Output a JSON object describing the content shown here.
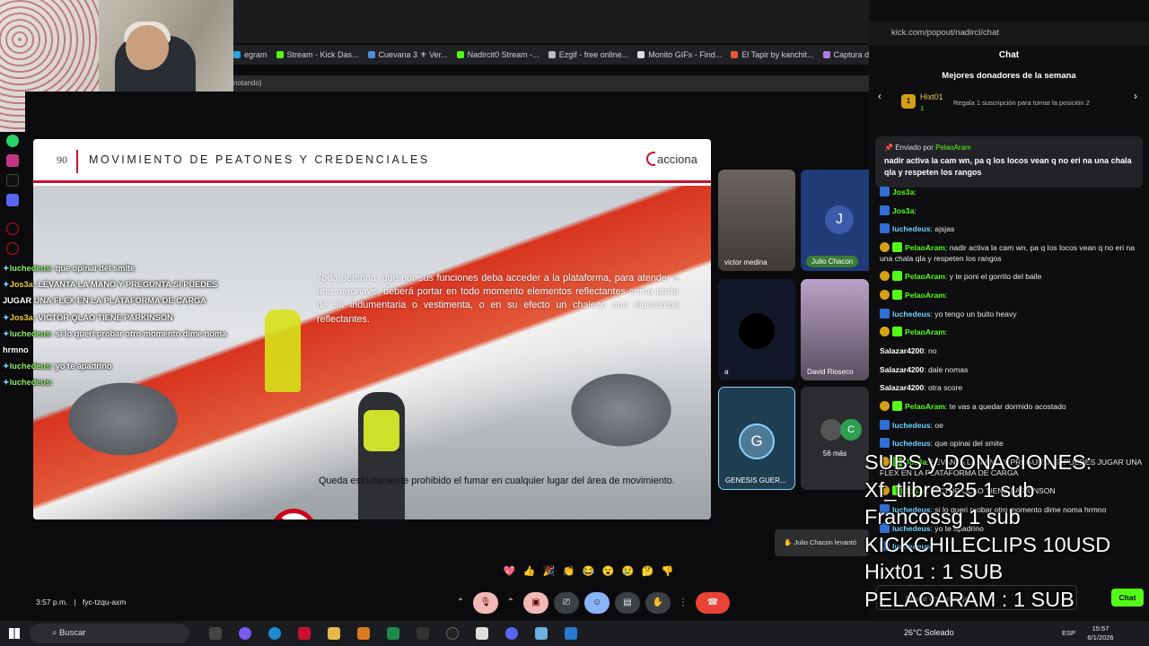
{
  "browser": {
    "bookmarks": [
      {
        "label": "egram",
        "color": "#2aa0e0"
      },
      {
        "label": "Stream - Kick Das...",
        "color": "#53fc18"
      },
      {
        "label": "Cuevana 3 ⚜ Ver...",
        "color": "#4f8bd6"
      },
      {
        "label": "Nadircit0 Stream -...",
        "color": "#53fc18"
      },
      {
        "label": "Ezgif - free online...",
        "color": "#bbbbbb"
      },
      {
        "label": "Monito GIFs - Find...",
        "color": "#dddddd"
      },
      {
        "label": "El Tapir by kanchit...",
        "color": "#e25a3a"
      },
      {
        "label": "Captura de",
        "color": "#b07be0"
      }
    ],
    "tab_suffix": "notando)"
  },
  "slide": {
    "number": "90",
    "title": "MOVIMIENTO DE PEATONES Y CREDENCIALES",
    "logo": "acciona",
    "paragraph1": "Toda persona, que por sus funciones deba acceder a la plataforma, para atender a una aeronave, deberá portar en todo momento elementos reflectantes como parte de su indumentaria o vestimenta, o en su efecto un chaleco con elementos reflectantes.",
    "paragraph2": "Queda estrictamente prohibido el fumar en cualquier lugar del área de movimiento."
  },
  "overlay_chat": [
    {
      "user": "luchedeus",
      "msg": "que opinai del smite",
      "gold": false
    },
    {
      "user": "Jos3a",
      "msg": "LEVANTA LA MANO Y PREGUNTA SI PUEDES JUGAR UNA FLEX EN LA PLATAFORMA DE CARGA",
      "gold": true
    },
    {
      "user": "Jos3a",
      "msg": "VICTOR QLAO TIENE PARKINSON",
      "gold": true
    },
    {
      "user": "luchedeus",
      "msg": "si lo queri probar otro momento dime noma hrmno",
      "gold": false
    },
    {
      "user": "luchedeus",
      "msg": "yo te apadrino",
      "gold": false
    },
    {
      "user": "luchedeus",
      "msg": "",
      "gold": false
    }
  ],
  "participants": {
    "victor": "victor medina",
    "julio_initial": "J",
    "julio": "Julio Chacon",
    "a": "a",
    "david": "David Rioseco",
    "genesis_initial": "G",
    "genesis": "GENESIS GUER...",
    "more_initial": "C",
    "more": "56 más"
  },
  "meet": {
    "time": "3:57 p.m.",
    "separator": "|",
    "code": "fyc-tzqu-axm",
    "toast": "Julio Chacon levantó",
    "reactions": [
      "💖",
      "👍",
      "🎉",
      "👏",
      "😂",
      "😮",
      "😢",
      "🤔",
      "👎"
    ]
  },
  "chat": {
    "url": "kick.com/popout/nadircl/chat",
    "title": "Chat",
    "donors_title": "Mejores donadores de la semana",
    "donor_rank": "1",
    "donor_name": "Hixt01",
    "donor_count": "1",
    "donor_cta": "Regala 1 suscripción para tomar la posición 2",
    "pinned_label": "Enviado por",
    "pinned_user": "PelaoAram",
    "pinned_msg": "nadir activa la cam wn, pa q los locos vean q no eri na una chala qla y respeten los rangos",
    "messages": [
      {
        "user": "Jos3a",
        "text": "",
        "badge": "blue",
        "ucls": "g"
      },
      {
        "user": "Jos3a",
        "text": "",
        "badge": "blue",
        "ucls": "g"
      },
      {
        "user": "luchedeus",
        "text": "ajsjas",
        "badge": "blue",
        "ucls": ""
      },
      {
        "user": "PelaoAram",
        "text": "nadir activa la cam wn, pa q los locos vean q no eri na una chala qla y respeten los rangos",
        "badge": "gold",
        "ucls": "g",
        "wrap": true
      },
      {
        "user": "PelaoAram",
        "text": "y te poni el gorrito del baile",
        "badge": "gold",
        "ucls": "g"
      },
      {
        "user": "PelaoAram",
        "text": "",
        "badge": "gold",
        "ucls": "g"
      },
      {
        "user": "luchedeus",
        "text": "yo tengo un bulto heavy",
        "badge": "blue",
        "ucls": ""
      },
      {
        "user": "PelaoAram",
        "text": "",
        "badge": "gold",
        "ucls": "g"
      },
      {
        "user": "Salazar4200",
        "text": "no",
        "badge": "",
        "ucls": "w"
      },
      {
        "user": "Salazar4200",
        "text": "dale nomas",
        "badge": "",
        "ucls": "w"
      },
      {
        "user": "Salazar4200",
        "text": "otra score",
        "badge": "",
        "ucls": "w"
      },
      {
        "user": "PelaoAram",
        "text": "te vas a quedar dormido acostado",
        "badge": "gold",
        "ucls": "g"
      },
      {
        "user": "luchedeus",
        "text": "oe",
        "badge": "blue",
        "ucls": ""
      },
      {
        "user": "luchedeus",
        "text": "que opinai del smite",
        "badge": "blue",
        "ucls": ""
      },
      {
        "user": "Jos3a",
        "text": "LEVANTA LA MANO Y PREGUNTA SI PUEDES JUGAR UNA FLEX EN LA PLATAFORMA DE CARGA",
        "badge": "gold",
        "ucls": "g",
        "wrap": true
      },
      {
        "user": "Jos3a",
        "text": "VICTOR QLAO TIENE PARKINSON",
        "badge": "gold",
        "ucls": "g"
      },
      {
        "user": "luchedeus",
        "text": "si lo queri probar otro momento dime noma hrmno",
        "badge": "blue",
        "ucls": ""
      },
      {
        "user": "luchedeus",
        "text": "yo te apadrino",
        "badge": "blue",
        "ucls": ""
      },
      {
        "user": "luchedeus",
        "text": "",
        "badge": "blue",
        "ucls": ""
      }
    ],
    "input_placeholder": "Enviar un mensaje",
    "send_label": "Chat"
  },
  "subs_overlay": [
    "SUBS y DONACIONES:",
    "Xf_tlibre325 1 sub",
    "Francossg 1 sub",
    "KICKCHILECLIPS 10USD",
    "Hixt01 : 1 SUB",
    "PELAOARAM : 1 SUB"
  ],
  "taskbar": {
    "search": "Buscar",
    "weather": "26°C  Soleado",
    "lang": "ESP",
    "time": "15:57",
    "date": "6/1/2026"
  }
}
